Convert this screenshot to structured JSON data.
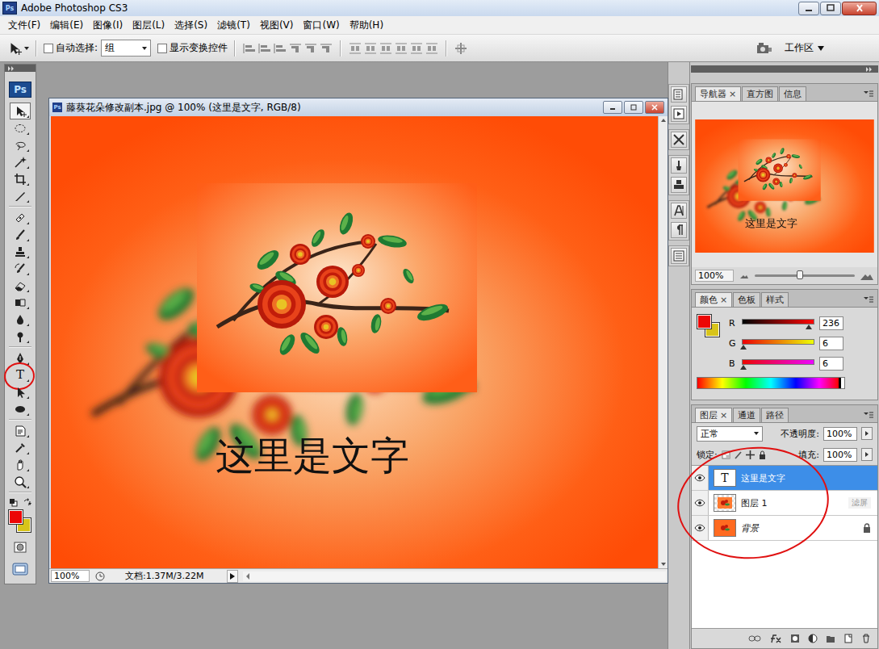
{
  "window": {
    "title": "Adobe Photoshop CS3",
    "logo": "Ps"
  },
  "menu": [
    "文件(F)",
    "编辑(E)",
    "图像(I)",
    "图层(L)",
    "选择(S)",
    "滤镜(T)",
    "视图(V)",
    "窗口(W)",
    "帮助(H)"
  ],
  "options_bar": {
    "auto_select": {
      "label": "自动选择:",
      "checked": false,
      "value": "组"
    },
    "show_transform": {
      "label": "显示变换控件",
      "checked": false
    },
    "workspace": "工作区"
  },
  "toolbox": {
    "logo": "Ps",
    "tools": [
      {
        "kind": "move",
        "selected": true,
        "circled": false
      },
      {
        "kind": "marquee",
        "selected": false,
        "circled": false
      },
      {
        "kind": "lasso",
        "selected": false,
        "circled": false
      },
      {
        "kind": "wand",
        "selected": false,
        "circled": false
      },
      {
        "kind": "crop",
        "selected": false,
        "circled": false
      },
      {
        "kind": "slice",
        "selected": false,
        "circled": false
      },
      {
        "kind": "heal",
        "selected": false,
        "circled": false
      },
      {
        "kind": "brush",
        "selected": false,
        "circled": false
      },
      {
        "kind": "stamp",
        "selected": false,
        "circled": false
      },
      {
        "kind": "history",
        "selected": false,
        "circled": false
      },
      {
        "kind": "eraser",
        "selected": false,
        "circled": false
      },
      {
        "kind": "gradient",
        "selected": false,
        "circled": false
      },
      {
        "kind": "blur",
        "selected": false,
        "circled": false
      },
      {
        "kind": "dodge",
        "selected": false,
        "circled": false
      },
      {
        "kind": "pen",
        "selected": false,
        "circled": false
      },
      {
        "kind": "text",
        "glyph": "T",
        "selected": false,
        "circled": true
      },
      {
        "kind": "path",
        "selected": false,
        "circled": false
      },
      {
        "kind": "shape",
        "selected": false,
        "circled": false
      },
      {
        "kind": "notes",
        "selected": false,
        "circled": false
      },
      {
        "kind": "eyedropper",
        "selected": false,
        "circled": false
      },
      {
        "kind": "hand",
        "selected": false,
        "circled": false
      },
      {
        "kind": "zoom",
        "selected": false,
        "circled": false
      }
    ]
  },
  "colors": {
    "foreground": "#ec0606",
    "background": "#d8c41a"
  },
  "document": {
    "title": "藤葵花朵修改副本.jpg @ 100% (这里是文字, RGB/8)",
    "canvas_text": "这里是文字",
    "zoom": "100%",
    "info": "文档:1.37M/3.22M"
  },
  "close_glyph": "×",
  "navigator": {
    "tabs": [
      {
        "label": "导航器",
        "selected": true
      },
      {
        "label": "直方图",
        "selected": false
      },
      {
        "label": "信息",
        "selected": false
      }
    ],
    "zoom": "100%",
    "level": 0.45
  },
  "color_panel": {
    "tabs": [
      {
        "label": "颜色",
        "selected": true
      },
      {
        "label": "色板",
        "selected": false
      },
      {
        "label": "样式",
        "selected": false
      }
    ],
    "channels": [
      {
        "name": "R",
        "value": "236",
        "level": 0.925
      },
      {
        "name": "G",
        "value": "6",
        "level": 0.024
      },
      {
        "name": "B",
        "value": "6",
        "level": 0.024
      }
    ]
  },
  "layers": {
    "tabs": [
      {
        "label": "图层",
        "selected": true
      },
      {
        "label": "通道",
        "selected": false
      },
      {
        "label": "路径",
        "selected": false
      }
    ],
    "blend_mode": "正常",
    "opacity_label": "不透明度:",
    "opacity": "100%",
    "lock_label": "锁定:",
    "fill_label": "填充:",
    "fill": "100%",
    "circled": true,
    "items": [
      {
        "name": "这里是文字",
        "kind": "text",
        "glyph": "T",
        "visible": true,
        "selected": true,
        "locked": false
      },
      {
        "name": "图层 1",
        "kind": "image",
        "visible": true,
        "selected": false,
        "locked": false,
        "hint": "滤屏"
      },
      {
        "name": "背景",
        "kind": "background",
        "visible": true,
        "selected": false,
        "locked": true
      }
    ]
  }
}
